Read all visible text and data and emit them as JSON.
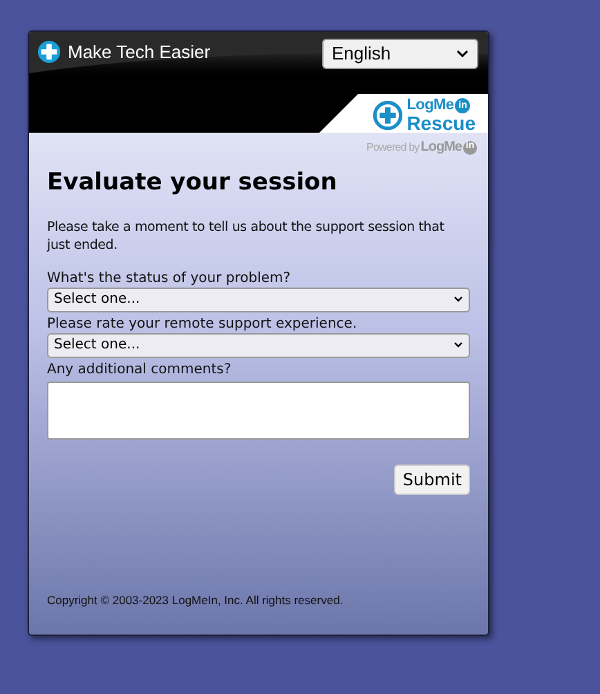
{
  "window": {
    "title": "Make Tech Easier"
  },
  "language": {
    "value": "English"
  },
  "logo": {
    "brand": "LogMe",
    "brand_badge": "in",
    "product": "Rescue"
  },
  "powered_by": {
    "prefix": "Powered by",
    "brand": "LogMe",
    "brand_badge": "in"
  },
  "form": {
    "heading": "Evaluate your session",
    "intro": "Please take a moment to tell us about the support session that just ended.",
    "fields": [
      {
        "kind": "select",
        "label": "What's the status of your problem?",
        "value": "Select one..."
      },
      {
        "kind": "select",
        "label": "Please rate your remote support experience.",
        "value": "Select one..."
      },
      {
        "kind": "textarea",
        "label": "Any additional comments?"
      }
    ],
    "submit": "Submit"
  },
  "footer": "Copyright © 2003-2023 LogMeIn, Inc. All rights reserved."
}
